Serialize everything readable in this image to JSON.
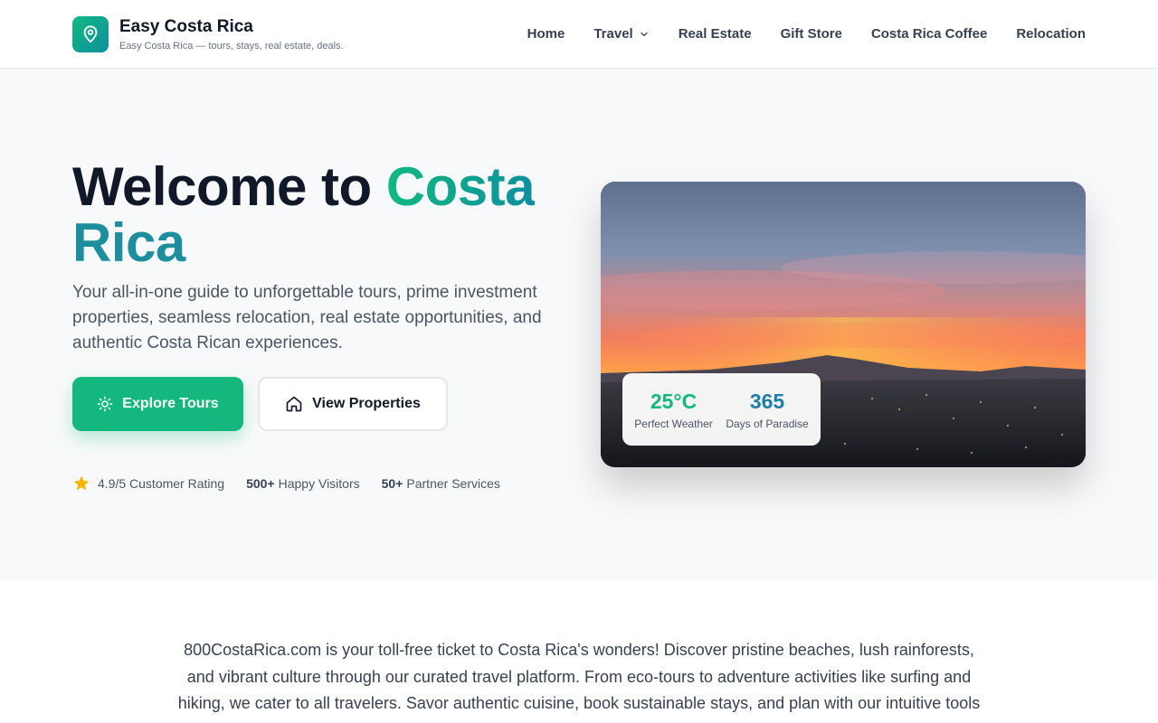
{
  "brand": {
    "name": "Easy Costa Rica",
    "tagline": "Easy Costa Rica — tours, stays, real estate, deals.",
    "logo_icon": "map-pin-icon"
  },
  "nav": {
    "items": [
      {
        "label": "Home"
      },
      {
        "label": "Travel",
        "has_dropdown": true
      },
      {
        "label": "Real Estate"
      },
      {
        "label": "Gift Store"
      },
      {
        "label": "Costa Rica Coffee"
      },
      {
        "label": "Relocation"
      }
    ]
  },
  "hero": {
    "title_prefix": "Welcome to ",
    "title_accent_1": "Costa",
    "title_accent_2": "Rica",
    "subtitle": "Your all-in-one guide to unforgettable tours, prime investment properties, seamless relocation, real estate opportunities, and authentic Costa Rican experiences.",
    "primary_button": "Explore Tours",
    "secondary_button": "View Properties",
    "stats": {
      "rating": "4.9/5 Customer Rating",
      "visitors_count": "500+",
      "visitors_label": "Happy Visitors",
      "partners_count": "50+",
      "partners_label": "Partner Services"
    },
    "weather_card": {
      "temperature": "25°C",
      "temperature_label": "Perfect Weather",
      "days": "365",
      "days_label": "Days of Paradise"
    }
  },
  "about": {
    "text": "800CostaRica.com is your toll-free ticket to Costa Rica's wonders! Discover pristine beaches, lush rainforests, and vibrant culture through our curated travel platform. From eco-tours to adventure activities like surfing and hiking, we cater to all travelers. Savor authentic cuisine, book sustainable stays, and plan with our intuitive tools"
  },
  "colors": {
    "accent_green": "#14b87e",
    "accent_teal": "#1e8e9e",
    "star": "#f5b400"
  }
}
